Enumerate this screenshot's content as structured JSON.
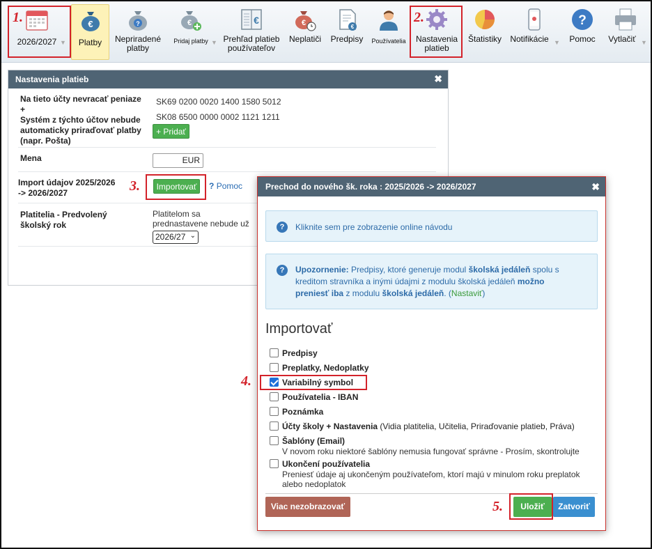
{
  "toolbar": {
    "items": [
      {
        "label": "2026/2027",
        "icon": "calendar-icon"
      },
      {
        "label": "Platby",
        "icon": "money-bag-euro-icon"
      },
      {
        "label": "Nepriradené platby",
        "icon": "money-bag-question-icon"
      },
      {
        "label": "Pridaj platby",
        "icon": "money-bag-add-icon"
      },
      {
        "label": "Prehľad platieb používateľov",
        "icon": "ledger-euro-icon"
      },
      {
        "label": "Neplatiči",
        "icon": "money-bag-clock-icon"
      },
      {
        "label": "Predpisy",
        "icon": "document-euro-icon"
      },
      {
        "label": "Používatelia",
        "icon": "user-icon"
      },
      {
        "label": "Nastavenia platieb",
        "icon": "gear-icon"
      },
      {
        "label": "Štatistiky",
        "icon": "pie-chart-icon"
      },
      {
        "label": "Notifikácie",
        "icon": "phone-icon"
      },
      {
        "label": "Pomoc",
        "icon": "help-icon"
      },
      {
        "label": "Vytlačiť",
        "icon": "printer-icon"
      }
    ]
  },
  "steps": [
    "1.",
    "2.",
    "3.",
    "4.",
    "5."
  ],
  "settings": {
    "title": "Nastavenia platieb",
    "accounts_label_1": "Na tieto účty nevracať peniaze",
    "plus": "+",
    "accounts_label_2": "Systém z týchto účtov nebude automaticky priraďovať platby (napr. Pošta)",
    "iban_1": "SK69 0200 0020 1400 1580 5012",
    "iban_2": "SK08 6500 0000 0002 1121 1211",
    "add_button": "+ Pridať",
    "currency_label": "Mena",
    "currency_value": "EUR",
    "import_label": "Import údajov 2025/2026 -> 2026/2027",
    "import_button": "Importovať",
    "help_link": "Pomoc",
    "payers_label": "Platitelia - Predvolený školský rok",
    "payers_text": "Platitelom sa prednastavene nebude už môcť platiť za pre",
    "year_select": "2026/27"
  },
  "modal": {
    "title": "Prechod do nového šk. roka : 2025/2026 -> 2026/2027",
    "info_link": "Kliknite sem pre zobrazenie online návodu",
    "warn_strong": "Upozornenie:",
    "warn_text_1": "Predpisy, ktoré generuje modul",
    "warn_em_1": "školská jedáleň",
    "warn_text_2": "spolu s kreditom stravníka a inými údajmi z modulu školská jedáleň",
    "warn_em_2": "možno preniesť iba",
    "warn_text_3": "z modulu",
    "warn_em_3": "školská jedáleň",
    "warn_link_open": "(",
    "warn_link": "Nastaviť",
    "warn_link_close": ")",
    "import_heading": "Importovať",
    "options": [
      {
        "label": "Predpisy",
        "checked": false
      },
      {
        "label": "Preplatky, Nedoplatky",
        "checked": false
      },
      {
        "label": "Variabilný symbol",
        "checked": true
      },
      {
        "label": "Používatelia - IBAN",
        "checked": false
      },
      {
        "label": "Poznámka",
        "checked": false
      },
      {
        "label": "Účty školy + Nastavenia",
        "extra": "(Vidia platitelia, Učitelia, Priraďovanie platieb, Práva)",
        "checked": false
      },
      {
        "label": "Šablóny (Email)",
        "desc": "V novom roku niektoré šablóny nemusia fungovať správne - Prosím, skontrolujte",
        "checked": false
      },
      {
        "label": "Ukončení používatelia",
        "desc": "Preniesť údaje aj ukončeným používateľom, ktorí majú v minulom roku preplatok alebo nedoplatok",
        "checked": false
      }
    ],
    "btn_hide": "Viac nezobrazovať",
    "btn_save": "Uložiť",
    "btn_close": "Zatvoriť"
  },
  "colors": {
    "header_bg": "#4f6474",
    "accent_red": "#d3222a",
    "green": "#4caf50",
    "blue_button": "#3a8fd0",
    "brown_button": "#b06557"
  }
}
